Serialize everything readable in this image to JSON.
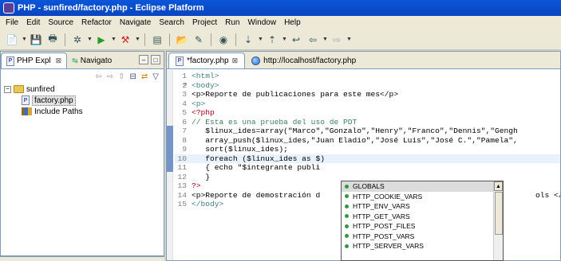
{
  "window": {
    "title": "PHP - sunfired/factory.php - Eclipse Platform"
  },
  "menu": [
    "File",
    "Edit",
    "Source",
    "Refactor",
    "Navigate",
    "Search",
    "Project",
    "Run",
    "Window",
    "Help"
  ],
  "left": {
    "tabs": [
      {
        "label": "PHP Expl",
        "close": "⊠"
      },
      {
        "label": "Navigato"
      }
    ],
    "tree": {
      "project": "sunfired",
      "file": "factory.php",
      "lib": "Include Paths"
    }
  },
  "editor": {
    "tabs": [
      {
        "label": "*factory.php",
        "close": "⊠"
      },
      {
        "label": "http://localhost/factory.php"
      }
    ]
  },
  "code": [
    {
      "n": "1",
      "text": "<html>",
      "cls": "tag"
    },
    {
      "n": "2",
      "text": "<body>",
      "cls": "tag",
      "fold": "⊖"
    },
    {
      "n": "3",
      "text": "<p>Reporte de publicaciones para este mes</p>",
      "cls": "mixed"
    },
    {
      "n": "4",
      "text": "<p>",
      "cls": "tag"
    },
    {
      "n": "5",
      "text": "<?php",
      "cls": "php"
    },
    {
      "n": "6",
      "text": "// Esta es una prueba del uso de PDT",
      "cls": "cm"
    },
    {
      "n": "7",
      "text": "   $linux_ides=array(\"Marco\",\"Gonzalo\",\"Henry\",\"Franco\",\"Dennis\",\"Gengh",
      "cls": "code"
    },
    {
      "n": "8",
      "text": "   array_push($linux_ides,\"Juan Eladio\",\"José Luis\",\"José C.\",\"Pamela\",",
      "cls": "code"
    },
    {
      "n": "9",
      "text": "   sort($linux_ides);",
      "cls": "code"
    },
    {
      "n": "10",
      "text": "   foreach ($linux_ides as $)",
      "cls": "code",
      "hl": true
    },
    {
      "n": "11",
      "text": "   { echo \"$integrante publi",
      "cls": "code"
    },
    {
      "n": "12",
      "text": "   }",
      "cls": "code"
    },
    {
      "n": "13",
      "text": "?>",
      "cls": "php"
    },
    {
      "n": "14",
      "text": "<p>Reporte de demostración d",
      "cls": "mixed",
      "tail": "ols </p>"
    },
    {
      "n": "15",
      "text": "</body>",
      "cls": "tag"
    }
  ],
  "autocomplete": [
    "GLOBALS",
    "HTTP_COOKIE_VARS",
    "HTTP_ENV_VARS",
    "HTTP_GET_VARS",
    "HTTP_POST_FILES",
    "HTTP_POST_VARS",
    "HTTP_SERVER_VARS"
  ]
}
